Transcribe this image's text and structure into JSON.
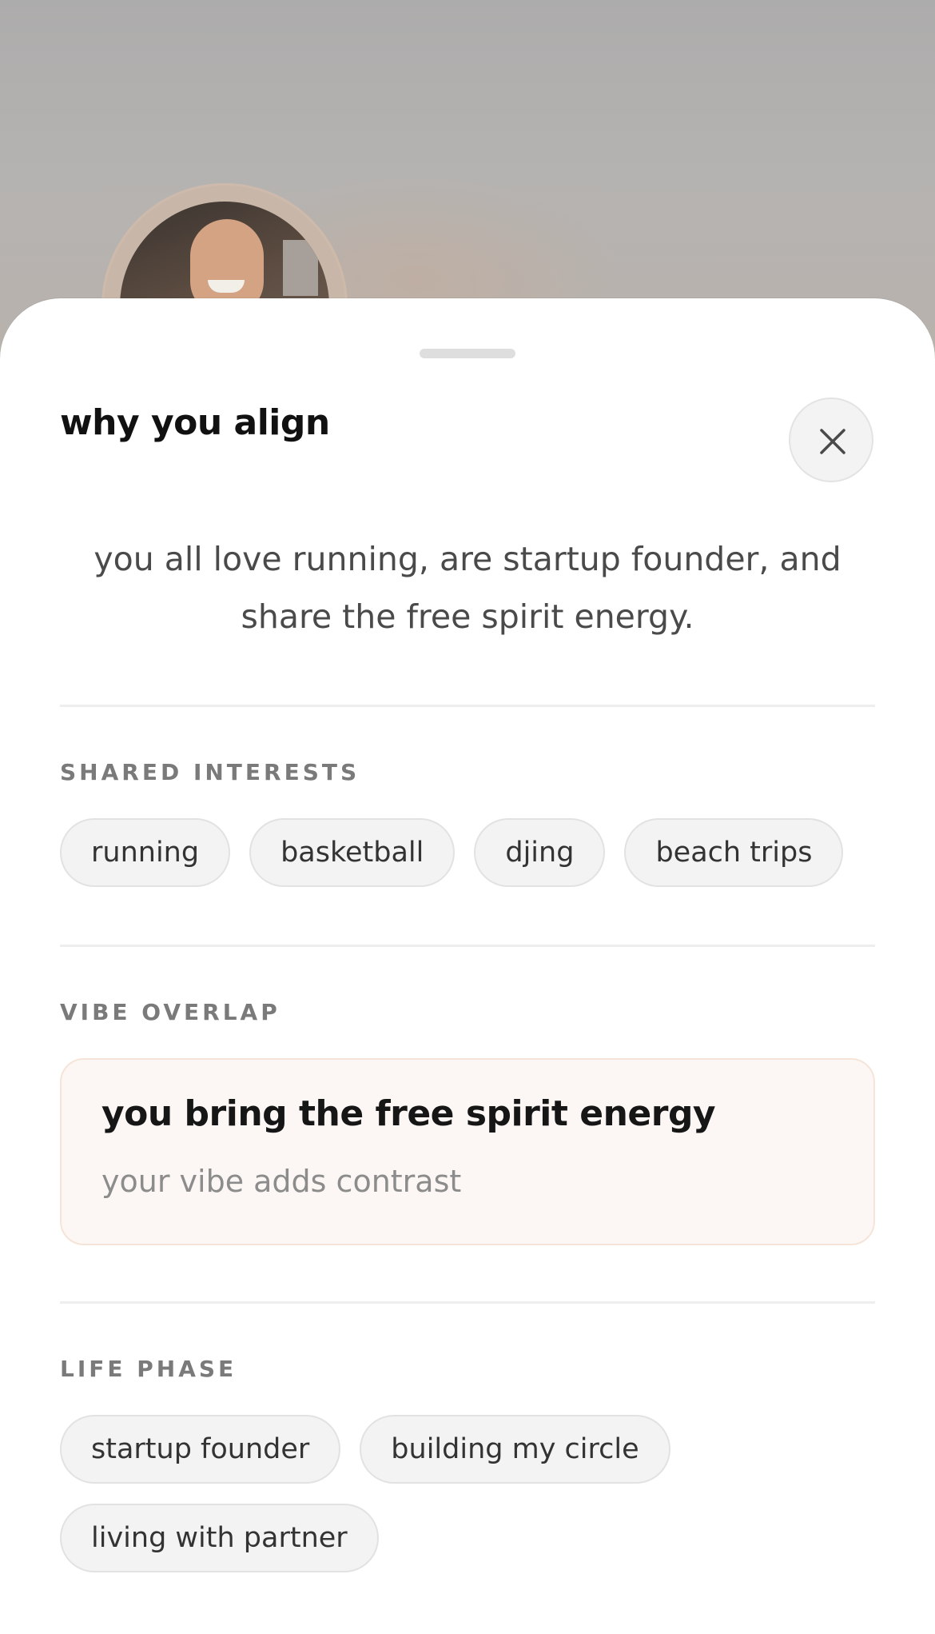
{
  "sheet": {
    "title": "why you align",
    "summary": "you all love running, are startup founder, and share the free spirit energy."
  },
  "shared_interests": {
    "label": "SHARED INTERESTS",
    "chips": [
      "running",
      "basketball",
      "djing",
      "beach trips"
    ]
  },
  "vibe_overlap": {
    "label": "VIBE OVERLAP",
    "title": "you bring the free spirit energy",
    "subtitle": "your vibe adds contrast"
  },
  "life_phase": {
    "label": "LIFE PHASE",
    "chips": [
      "startup founder",
      "building my circle",
      "living with partner"
    ]
  },
  "icons": {
    "close": "close-icon"
  }
}
